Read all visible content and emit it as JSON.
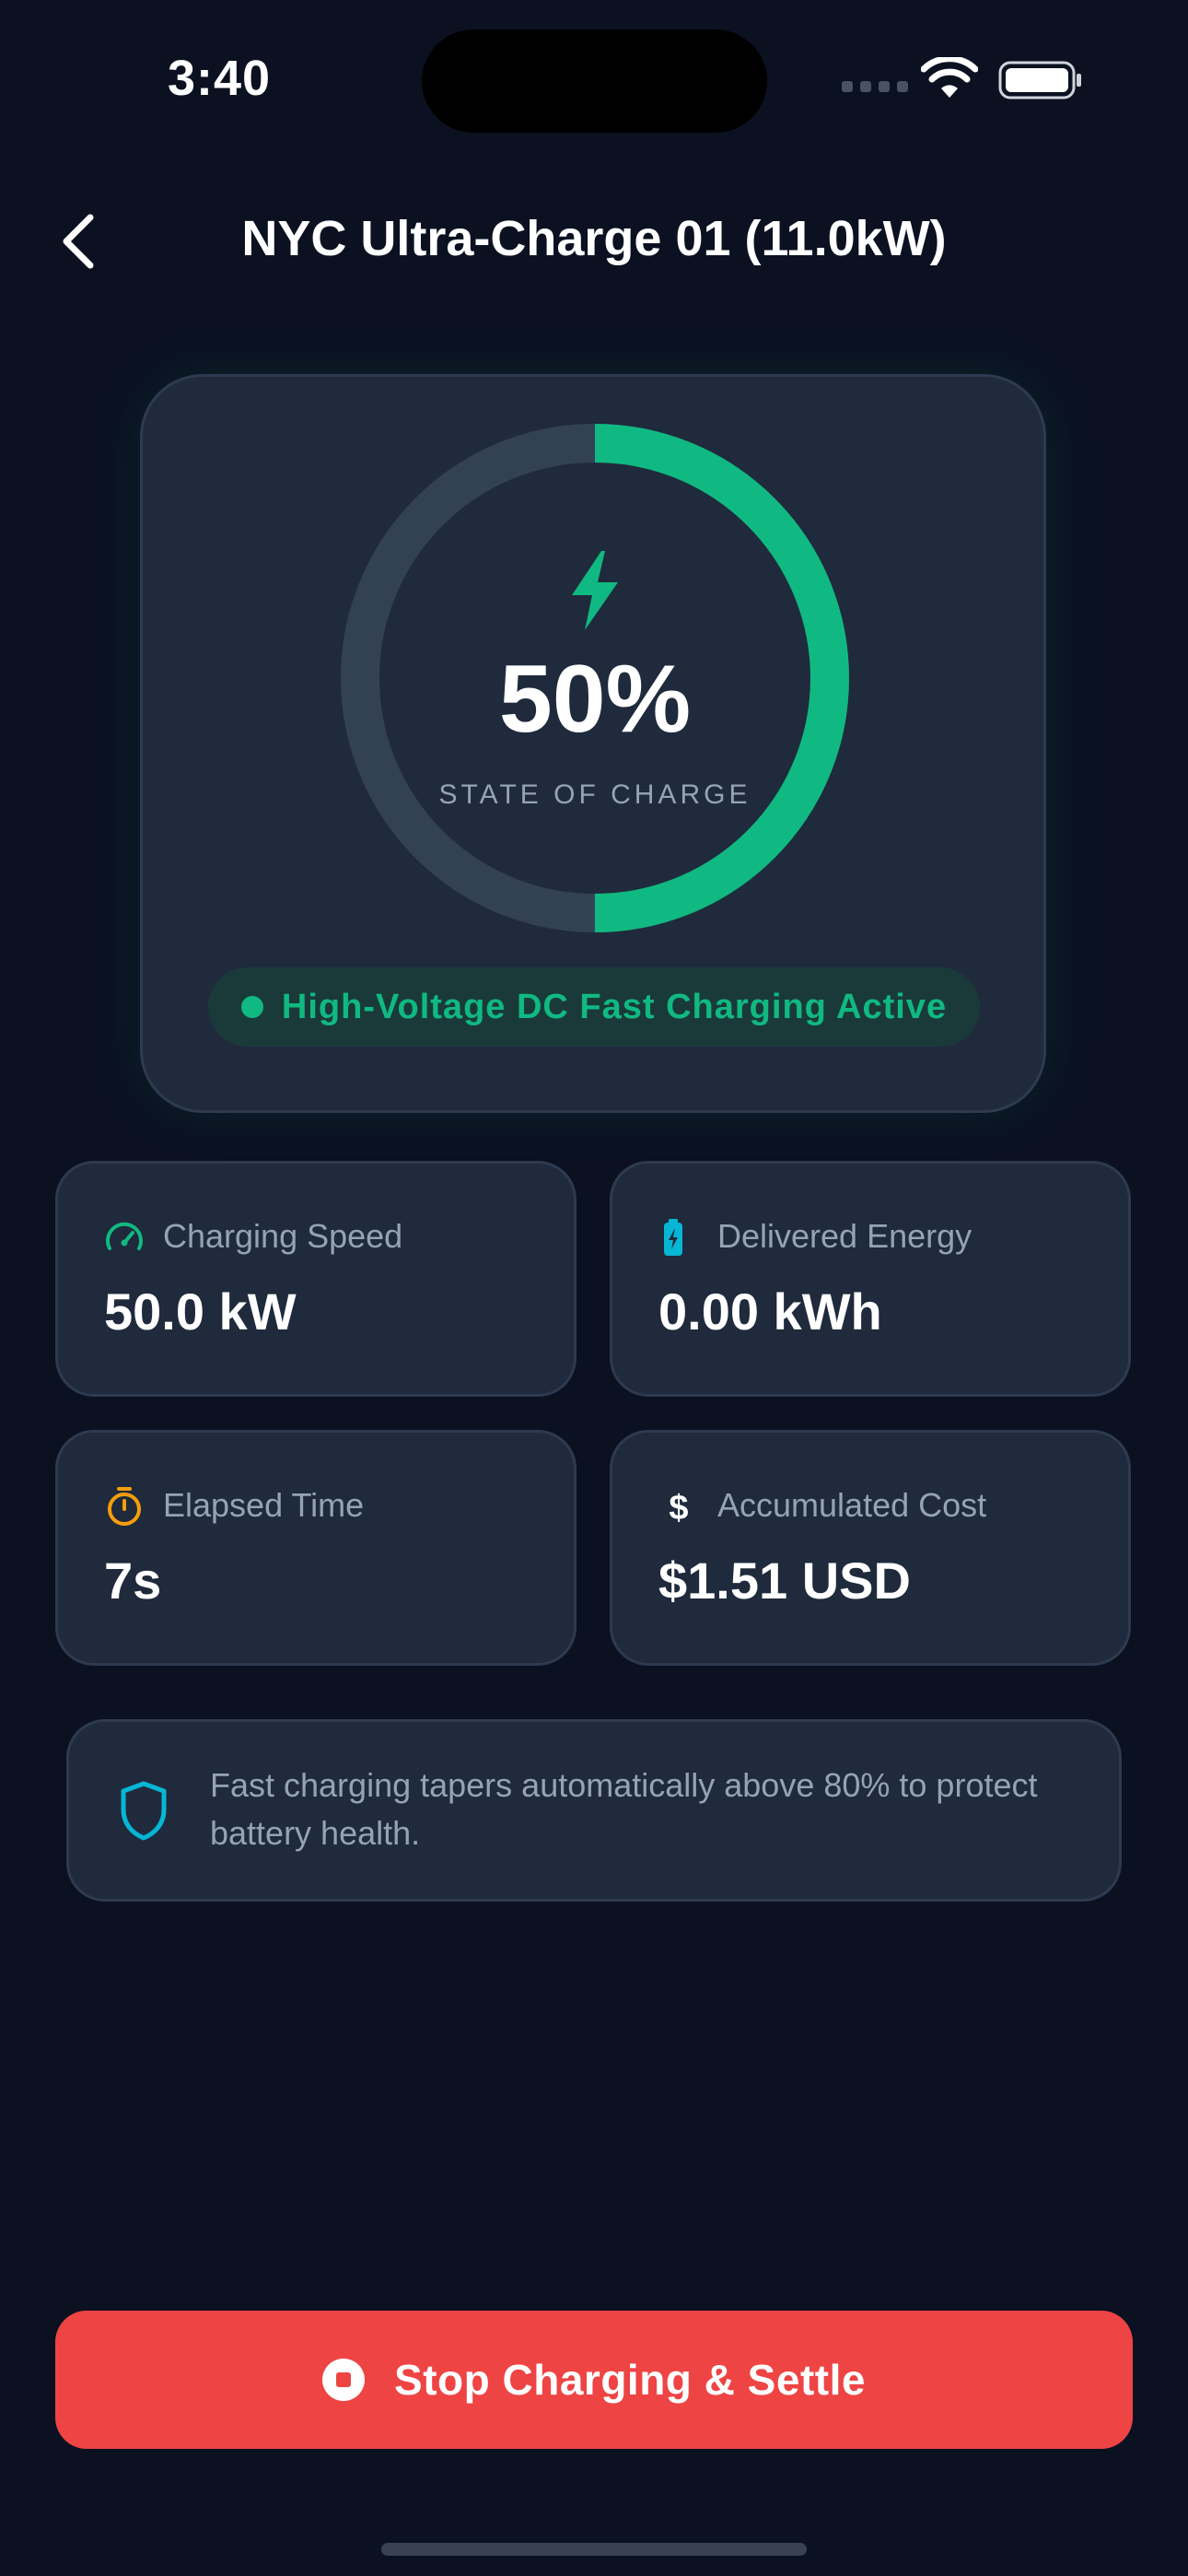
{
  "status_bar": {
    "time": "3:40"
  },
  "header": {
    "title": "NYC Ultra-Charge 01 (11.0kW)"
  },
  "charge": {
    "percent_label": "50%",
    "percent_value": 0.5,
    "sublabel": "STATE OF CHARGE",
    "status": "High-Voltage DC Fast Charging Active"
  },
  "stats": [
    {
      "label": "Charging Speed",
      "value": "50.0 kW",
      "icon": "speedometer-icon"
    },
    {
      "label": "Delivered Energy",
      "value": "0.00 kWh",
      "icon": "battery-charging-icon"
    },
    {
      "label": "Elapsed Time",
      "value": "7s",
      "icon": "stopwatch-icon"
    },
    {
      "label": "Accumulated Cost",
      "value": "$1.51 USD",
      "icon": "dollar-icon"
    }
  ],
  "info": {
    "text": "Fast charging tapers automatically above 80% to protect battery health."
  },
  "action": {
    "stop_label": "Stop Charging & Settle"
  },
  "colors": {
    "background": "#0b1121",
    "card": "#1f2a3c",
    "accent_green": "#10b981",
    "accent_cyan": "#06b6d4",
    "accent_amber": "#f59e0b",
    "danger": "#ef4444"
  }
}
